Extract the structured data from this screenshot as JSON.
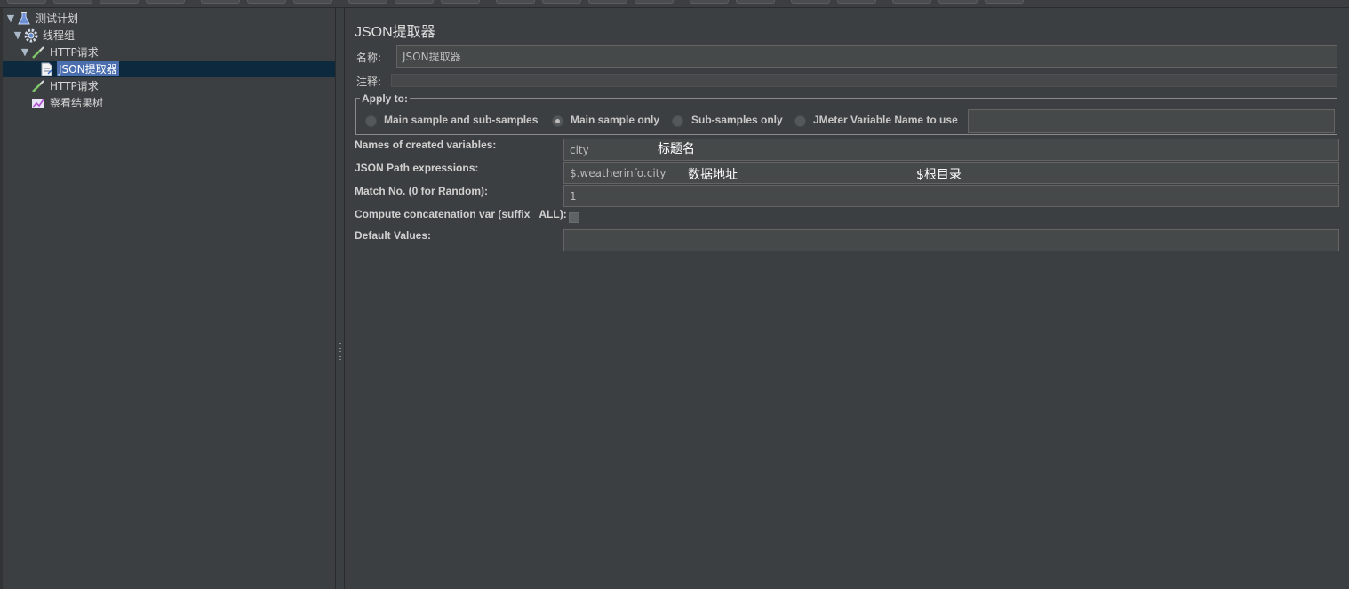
{
  "tree": {
    "nodes": [
      {
        "label": "测试计划",
        "icon": "test-plan-flask-icon"
      },
      {
        "label": "线程组",
        "icon": "thread-group-gear-icon"
      },
      {
        "label": "HTTP请求",
        "icon": "http-sampler-pipette-icon"
      },
      {
        "label": "JSON提取器",
        "icon": "json-extractor-document-icon"
      },
      {
        "label": "HTTP请求",
        "icon": "http-sampler-pipette-icon"
      },
      {
        "label": "察看结果树",
        "icon": "results-tree-chart-icon"
      }
    ]
  },
  "panel": {
    "title": "JSON提取器",
    "name_label": "名称:",
    "name_value": "JSON提取器",
    "comment_label": "注释:",
    "comment_value": "",
    "apply_to": {
      "legend": "Apply to:",
      "options": [
        "Main sample and sub-samples",
        "Main sample only",
        "Sub-samples only",
        "JMeter Variable Name to use"
      ],
      "selected": "Main sample only",
      "variable_value": ""
    },
    "fields": {
      "names_label": "Names of created variables:",
      "names_value": "city",
      "path_label": "JSON Path expressions:",
      "path_value": "$.weatherinfo.city",
      "match_label": "Match No. (0 for Random):",
      "match_value": "1",
      "concat_label": "Compute concatenation var (suffix _ALL):",
      "concat_checked": false,
      "default_label": "Default Values:",
      "default_value": ""
    },
    "annotations": {
      "names_note": "标题名",
      "path_note": "数据地址",
      "root_note": "$根目录"
    }
  }
}
